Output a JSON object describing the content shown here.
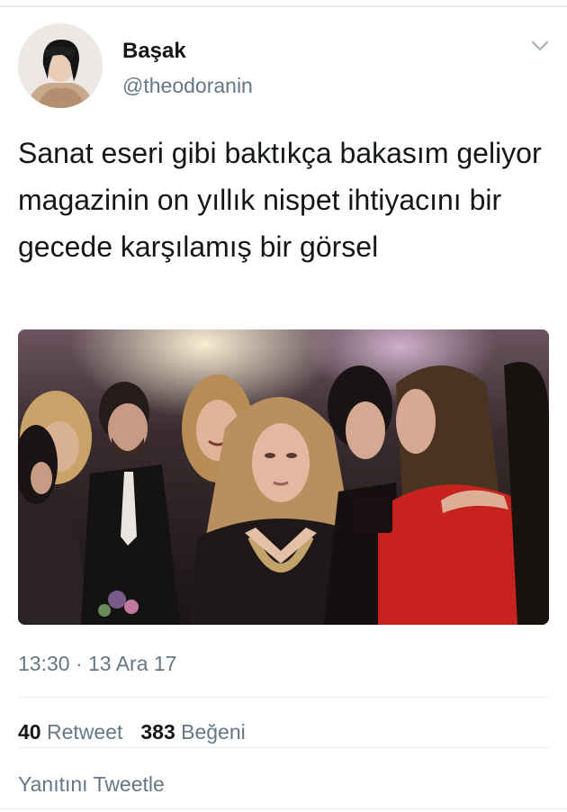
{
  "tweet": {
    "author": {
      "display_name": "Başak",
      "handle": "@theodoranin",
      "avatar_icon": "profile-avatar"
    },
    "menu_icon": "chevron-down-icon",
    "text": "Sanat eseri gibi baktıkça bakasım geliyor magazinin on yıllık nispet ihtiyacını bir gecede karşılamış bir görsel",
    "media": {
      "kind": "photo"
    },
    "timestamp": "13:30 · 13 Ara 17",
    "stats": {
      "retweets_count": "40",
      "retweets_label": "Retweet",
      "likes_count": "383",
      "likes_label": "Beğeni"
    },
    "reply_placeholder": "Yanıtını Tweetle"
  },
  "colors": {
    "text_primary": "#14171a",
    "text_secondary": "#657786",
    "divider": "#e6ecf0"
  }
}
